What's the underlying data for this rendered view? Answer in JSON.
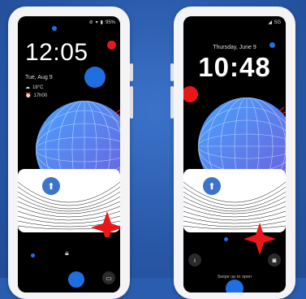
{
  "left_phone": {
    "status_text": "95%",
    "clock": "12:05",
    "date": "Tue, Aug 9",
    "weather": "18°C",
    "alarm": "17h00",
    "lock_icon": "lock-icon",
    "wallet_icon": "wallet-icon",
    "chip_icon": "tree-icon"
  },
  "right_phone": {
    "status_text": "5G",
    "date": "Thursday, June 9",
    "clock": "10:48",
    "swipe_hint": "Swipe up to open",
    "flashlight_icon": "flashlight-icon",
    "camera_icon": "camera-icon",
    "chip_icon": "tree-icon"
  },
  "colors": {
    "background": "#2a5db0",
    "accent_blue": "#1f6fe0",
    "accent_red": "#e8171c",
    "globe_light": "#4aa3ff",
    "globe_dark": "#6e5bd8"
  }
}
